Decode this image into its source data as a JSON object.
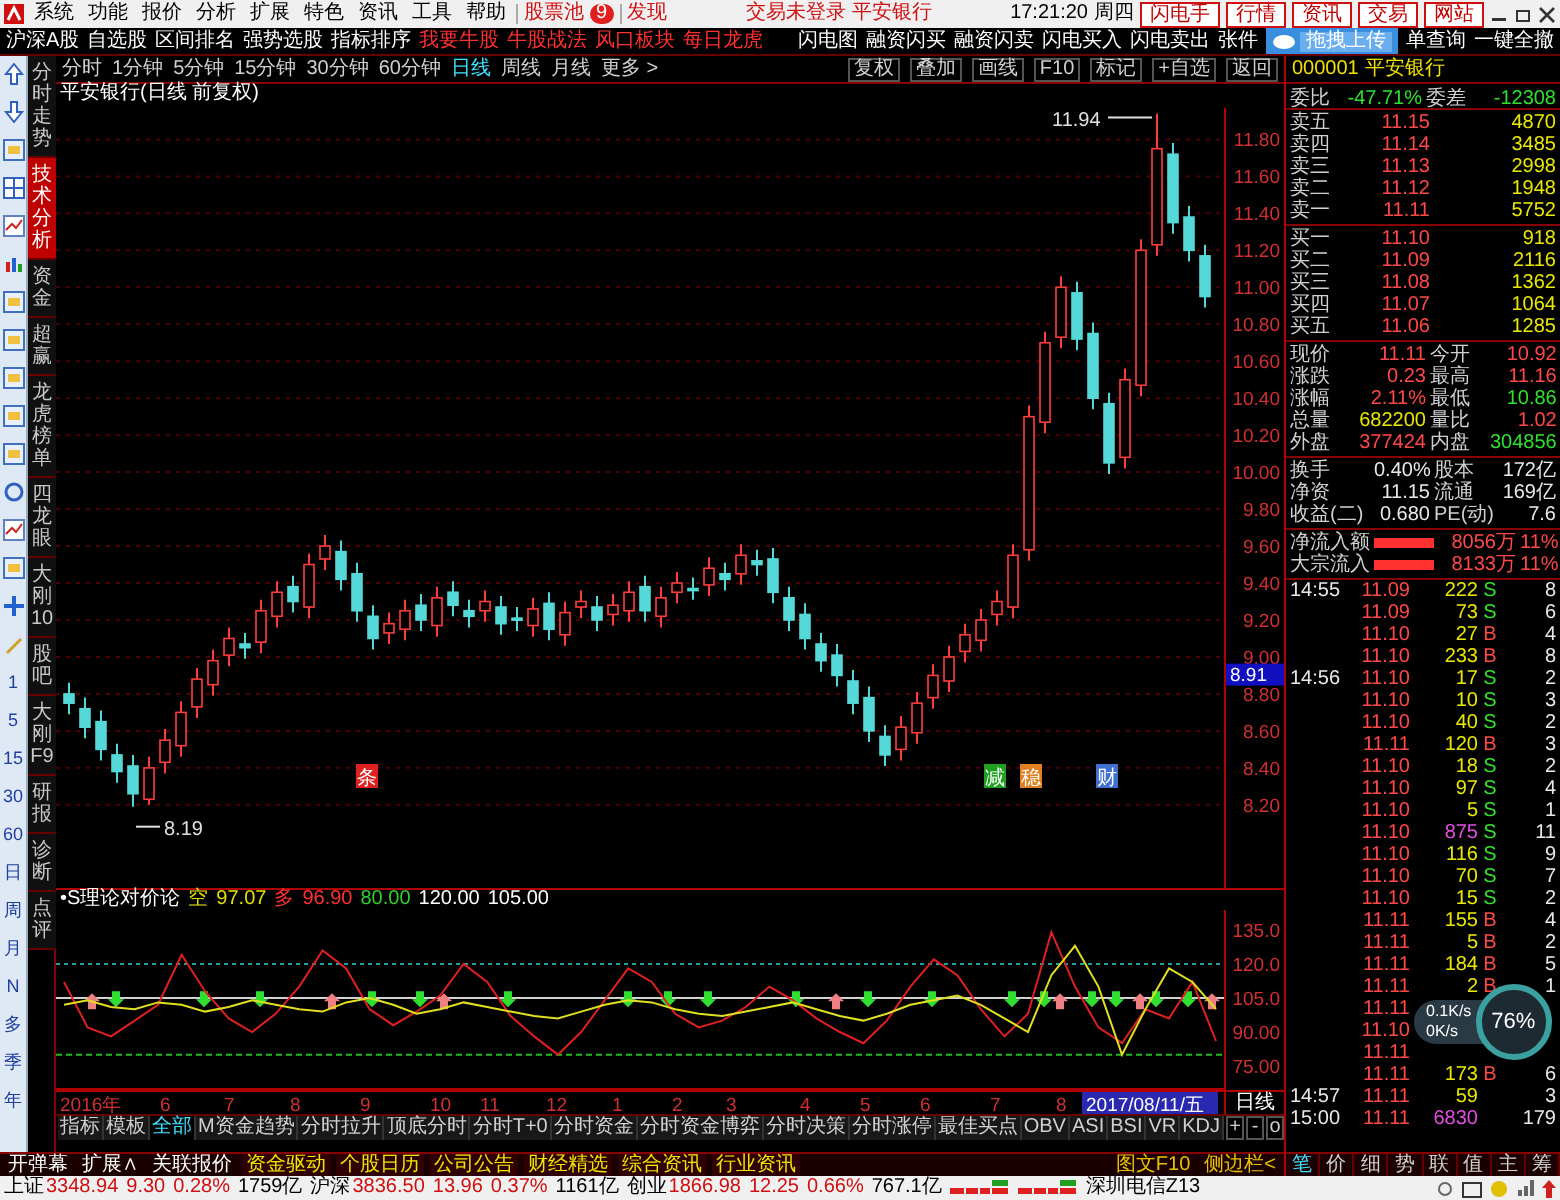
{
  "menu_bar": {
    "items": [
      "系统",
      "功能",
      "报价",
      "分析",
      "扩展",
      "特色",
      "资讯",
      "工具",
      "帮助"
    ],
    "stock_pool": "股票池",
    "stock_pool_count": "9",
    "discover": "发现",
    "login_status": "交易未登录",
    "stock_name": "平安银行",
    "time": "17:21:20",
    "weekday": "周四",
    "buttons": [
      "闪电手",
      "行情",
      "资讯",
      "交易",
      "网站"
    ]
  },
  "toolbar": {
    "left": [
      {
        "label": "沪深A股",
        "kind": "normal"
      },
      {
        "label": "自选股",
        "kind": "normal"
      },
      {
        "label": "区间排名",
        "kind": "normal"
      },
      {
        "label": "强势选股",
        "kind": "normal"
      },
      {
        "label": "指标排序",
        "kind": "normal"
      },
      {
        "label": "我要牛股",
        "kind": "promo"
      },
      {
        "label": "牛股战法",
        "kind": "promo"
      },
      {
        "label": "风口板块",
        "kind": "promo"
      },
      {
        "label": "每日龙虎",
        "kind": "promo"
      }
    ],
    "right": [
      "闪电图",
      "融资闪买",
      "融资闪卖",
      "闪电买入",
      "闪电卖出",
      "张件"
    ],
    "upload_popup": "拖拽上传",
    "right_after": [
      "单查询",
      "一键全撤"
    ]
  },
  "sidebar": {
    "period_keys": [
      "1",
      "5",
      "15",
      "30",
      "60",
      "日",
      "周",
      "月",
      "N",
      "多",
      "季",
      "年"
    ]
  },
  "vertical_tabs": [
    {
      "label": "分时走势",
      "selected": false
    },
    {
      "label": "技术分析",
      "selected": true
    },
    {
      "label": "资金",
      "selected": false
    },
    {
      "label": "超赢",
      "selected": false
    },
    {
      "label": "龙虎榜单",
      "selected": false
    },
    {
      "label": "四龙眼",
      "selected": false
    },
    {
      "label": "大刚10",
      "selected": false
    },
    {
      "label": "股吧",
      "selected": false
    },
    {
      "label": "大刚F9",
      "selected": false
    },
    {
      "label": "研报",
      "selected": false
    },
    {
      "label": "诊断",
      "selected": false
    },
    {
      "label": "点评",
      "selected": false
    }
  ],
  "period_bar": {
    "periods": [
      {
        "label": "分时",
        "selected": false
      },
      {
        "label": "1分钟",
        "selected": false
      },
      {
        "label": "5分钟",
        "selected": false
      },
      {
        "label": "15分钟",
        "selected": false
      },
      {
        "label": "30分钟",
        "selected": false
      },
      {
        "label": "60分钟",
        "selected": false
      },
      {
        "label": "日线",
        "selected": true
      },
      {
        "label": "周线",
        "selected": false
      },
      {
        "label": "月线",
        "selected": false
      },
      {
        "label": "更多 >",
        "selected": false
      }
    ],
    "actions": [
      "复权",
      "叠加",
      "画线",
      "F10",
      "标记",
      "+自选",
      "返回"
    ]
  },
  "price_chart": {
    "title": "平安银行(日线 前复权)",
    "chart_data": {
      "type": "candlestick",
      "grid": true,
      "ylim": [
        7.75,
        11.97
      ],
      "yticks": [
        {
          "value": 11.8,
          "label": "11.80"
        },
        {
          "value": 11.6,
          "label": "11.60"
        },
        {
          "value": 11.4,
          "label": "11.40"
        },
        {
          "value": 11.2,
          "label": "11.20"
        },
        {
          "value": 11.0,
          "label": "11.00"
        },
        {
          "value": 10.8,
          "label": "10.80"
        },
        {
          "value": 10.6,
          "label": "10.60"
        },
        {
          "value": 10.4,
          "label": "10.40"
        },
        {
          "value": 10.2,
          "label": "10.20"
        },
        {
          "value": 10.0,
          "label": "10.00"
        },
        {
          "value": 9.8,
          "label": "9.80"
        },
        {
          "value": 9.6,
          "label": "9.60"
        },
        {
          "value": 9.4,
          "label": "9.40"
        },
        {
          "value": 9.2,
          "label": "9.20"
        },
        {
          "value": 9.0,
          "label": "9.00"
        },
        {
          "value": 8.8,
          "label": "8.80"
        },
        {
          "value": 8.6,
          "label": "8.60"
        },
        {
          "value": 8.4,
          "label": "8.40"
        },
        {
          "value": 8.2,
          "label": "8.20"
        }
      ],
      "ohlc": [
        [
          8.8,
          8.86,
          8.69,
          8.75
        ],
        [
          8.72,
          8.78,
          8.56,
          8.62
        ],
        [
          8.65,
          8.71,
          8.44,
          8.5
        ],
        [
          8.47,
          8.53,
          8.32,
          8.38
        ],
        [
          8.41,
          8.47,
          8.19,
          8.26
        ],
        [
          8.23,
          8.46,
          8.2,
          8.4
        ],
        [
          8.43,
          8.61,
          8.37,
          8.55
        ],
        [
          8.52,
          8.76,
          8.46,
          8.7
        ],
        [
          8.73,
          8.94,
          8.67,
          8.88
        ],
        [
          8.85,
          9.04,
          8.79,
          8.98
        ],
        [
          9.01,
          9.16,
          8.95,
          9.1
        ],
        [
          9.07,
          9.13,
          8.99,
          9.05
        ],
        [
          9.08,
          9.31,
          9.02,
          9.25
        ],
        [
          9.22,
          9.41,
          9.16,
          9.35
        ],
        [
          9.38,
          9.44,
          9.24,
          9.3
        ],
        [
          9.27,
          9.56,
          9.21,
          9.5
        ],
        [
          9.53,
          9.66,
          9.47,
          9.6
        ],
        [
          9.57,
          9.63,
          9.36,
          9.42
        ],
        [
          9.45,
          9.51,
          9.19,
          9.25
        ],
        [
          9.22,
          9.28,
          9.04,
          9.1
        ],
        [
          9.13,
          9.24,
          9.07,
          9.18
        ],
        [
          9.15,
          9.31,
          9.09,
          9.25
        ],
        [
          9.28,
          9.34,
          9.14,
          9.2
        ],
        [
          9.17,
          9.38,
          9.11,
          9.32
        ],
        [
          9.35,
          9.41,
          9.22,
          9.28
        ],
        [
          9.25,
          9.31,
          9.16,
          9.22
        ],
        [
          9.25,
          9.36,
          9.19,
          9.3
        ],
        [
          9.27,
          9.33,
          9.12,
          9.18
        ],
        [
          9.21,
          9.27,
          9.14,
          9.2
        ],
        [
          9.17,
          9.32,
          9.11,
          9.26
        ],
        [
          9.29,
          9.35,
          9.09,
          9.15
        ],
        [
          9.12,
          9.3,
          9.06,
          9.24
        ],
        [
          9.27,
          9.36,
          9.21,
          9.3
        ],
        [
          9.27,
          9.33,
          9.14,
          9.2
        ],
        [
          9.23,
          9.34,
          9.17,
          9.28
        ],
        [
          9.25,
          9.41,
          9.19,
          9.35
        ],
        [
          9.38,
          9.44,
          9.19,
          9.25
        ],
        [
          9.22,
          9.38,
          9.16,
          9.32
        ],
        [
          9.35,
          9.46,
          9.29,
          9.4
        ],
        [
          9.37,
          9.43,
          9.31,
          9.36
        ],
        [
          9.39,
          9.54,
          9.33,
          9.48
        ],
        [
          9.45,
          9.51,
          9.36,
          9.42
        ],
        [
          9.45,
          9.61,
          9.39,
          9.55
        ],
        [
          9.52,
          9.58,
          9.44,
          9.5
        ],
        [
          9.53,
          9.59,
          9.29,
          9.35
        ],
        [
          9.32,
          9.38,
          9.14,
          9.2
        ],
        [
          9.23,
          9.29,
          9.04,
          9.1
        ],
        [
          9.07,
          9.13,
          8.92,
          8.98
        ],
        [
          9.01,
          9.07,
          8.84,
          8.9
        ],
        [
          8.87,
          8.93,
          8.69,
          8.75
        ],
        [
          8.78,
          8.84,
          8.54,
          8.6
        ],
        [
          8.57,
          8.63,
          8.41,
          8.47
        ],
        [
          8.5,
          8.68,
          8.44,
          8.62
        ],
        [
          8.59,
          8.81,
          8.53,
          8.75
        ],
        [
          8.78,
          8.96,
          8.72,
          8.9
        ],
        [
          8.87,
          9.06,
          8.81,
          9.0
        ],
        [
          9.03,
          9.18,
          8.97,
          9.12
        ],
        [
          9.09,
          9.26,
          9.03,
          9.2
        ],
        [
          9.23,
          9.36,
          9.17,
          9.3
        ],
        [
          9.27,
          9.61,
          9.21,
          9.55
        ],
        [
          9.58,
          10.36,
          9.52,
          10.3
        ],
        [
          10.27,
          10.76,
          10.21,
          10.7
        ],
        [
          10.73,
          11.06,
          10.67,
          11.0
        ],
        [
          10.97,
          11.03,
          10.66,
          10.72
        ],
        [
          10.75,
          10.81,
          10.34,
          10.4
        ],
        [
          10.37,
          10.43,
          9.99,
          10.05
        ],
        [
          10.08,
          10.56,
          10.02,
          10.5
        ],
        [
          10.47,
          11.26,
          10.41,
          11.2
        ],
        [
          11.23,
          11.94,
          11.17,
          11.75
        ],
        [
          11.72,
          11.78,
          11.29,
          11.35
        ],
        [
          11.38,
          11.44,
          11.14,
          11.2
        ],
        [
          11.17,
          11.23,
          10.89,
          10.95
        ]
      ]
    },
    "high_label": "11.94",
    "low_label": "8.19",
    "current_marker": "8.91",
    "event_markers": [
      {
        "label": "条",
        "color": "#e02020"
      },
      {
        "label": "减",
        "color": "#20a020"
      },
      {
        "label": "稳",
        "color": "#e08020"
      },
      {
        "label": "财",
        "color": "#4070d0"
      }
    ]
  },
  "indicator": {
    "header": [
      {
        "text": "•S理论对价论",
        "color": "#ffffff"
      },
      {
        "text": "空",
        "color": "#e0e000"
      },
      {
        "text": "97.07",
        "color": "#e0e000"
      },
      {
        "text": "多",
        "color": "#ff3030"
      },
      {
        "text": "96.90",
        "color": "#ff3030"
      },
      {
        "text": "80.00",
        "color": "#30d030"
      },
      {
        "text": "120.00",
        "color": "#ffffff"
      },
      {
        "text": "105.00",
        "color": "#ffffff"
      }
    ],
    "chart_data": {
      "type": "line",
      "ylim": [
        64.4,
        143.8
      ],
      "yticks": [
        {
          "value": 135,
          "label": "135.0"
        },
        {
          "value": 120,
          "label": "120.0"
        },
        {
          "value": 105,
          "label": "105.0"
        },
        {
          "value": 90,
          "label": "90.00"
        },
        {
          "value": 75,
          "label": "75.00"
        }
      ],
      "series": [
        {
          "color": "#e02020",
          "values": [
            112,
            92,
            88,
            95,
            102,
            124,
            108,
            96,
            90,
            98,
            110,
            126,
            118,
            100,
            93,
            99,
            106,
            120,
            112,
            97,
            88,
            80,
            90,
            104,
            118,
            112,
            98,
            92,
            95,
            101,
            110,
            104,
            96,
            90,
            85,
            95,
            110,
            122,
            115,
            100,
            88,
            98,
            134,
            110,
            92,
            85,
            100,
            96,
            112,
            86
          ]
        },
        {
          "color": "#e0e020",
          "values": [
            102,
            104,
            101,
            100,
            103,
            102,
            99,
            101,
            104,
            102,
            100,
            99,
            103,
            105,
            102,
            98,
            100,
            103,
            101,
            99,
            97,
            96,
            99,
            102,
            104,
            103,
            100,
            98,
            97,
            99,
            101,
            103,
            100,
            97,
            95,
            98,
            102,
            104,
            106,
            102,
            96,
            90,
            115,
            128,
            110,
            80,
            100,
            118,
            112,
            100
          ]
        }
      ]
    }
  },
  "date_axis": {
    "labels": [
      "2016年",
      "6",
      "7",
      "8",
      "9",
      "10",
      "11",
      "12",
      "1",
      "2",
      "3",
      "4",
      "5",
      "6",
      "7",
      "8"
    ],
    "cursor_date": "2017/08/11/五",
    "period": "日线"
  },
  "indicator_tabs": {
    "tabs": [
      {
        "label": "指标",
        "selected": false
      },
      {
        "label": "模板",
        "selected": false
      },
      {
        "label": "全部",
        "selected": true
      },
      {
        "label": "M资金趋势",
        "selected": false
      },
      {
        "label": "分时拉升",
        "selected": false
      },
      {
        "label": "顶底分时",
        "selected": false
      },
      {
        "label": "分时T+0",
        "selected": false
      },
      {
        "label": "分时资金",
        "selected": false
      },
      {
        "label": "分时资金博弈",
        "selected": false
      },
      {
        "label": "分时决策",
        "selected": false
      },
      {
        "label": "分时涨停",
        "selected": false
      },
      {
        "label": "最佳买点",
        "selected": false
      },
      {
        "label": "OBV",
        "selected": false
      },
      {
        "label": "ASI",
        "selected": false
      },
      {
        "label": "BSI",
        "selected": false
      },
      {
        "label": "VR",
        "selected": false
      },
      {
        "label": "KDJ",
        "selected": false
      }
    ],
    "zoom_buttons": [
      "+",
      "-",
      "o"
    ]
  },
  "bottom_bar": {
    "left": [
      {
        "label": "开弹幕",
        "kind": "plain"
      },
      {
        "label": "扩展∧",
        "kind": "plain"
      },
      {
        "label": "关联报价",
        "kind": "plain"
      },
      {
        "label": "资金驱动",
        "kind": "news"
      },
      {
        "label": "个股日历",
        "kind": "news"
      },
      {
        "label": "公司公告",
        "kind": "news"
      },
      {
        "label": "财经精选",
        "kind": "news"
      },
      {
        "label": "综合资讯",
        "kind": "news"
      },
      {
        "label": "行业资讯",
        "kind": "news"
      }
    ],
    "right": [
      "图文F10",
      "侧边栏<"
    ]
  },
  "quote_panel": {
    "code": "000001",
    "name": "平安银行",
    "ratio": {
      "label": "委比",
      "value": "-47.71%",
      "diff_label": "委差",
      "diff": "-12308"
    },
    "asks": [
      {
        "label": "卖五",
        "price": "11.15",
        "volume": "4870"
      },
      {
        "label": "卖四",
        "price": "11.14",
        "volume": "3485"
      },
      {
        "label": "卖三",
        "price": "11.13",
        "volume": "2998"
      },
      {
        "label": "卖二",
        "price": "11.12",
        "volume": "1948"
      },
      {
        "label": "卖一",
        "price": "11.11",
        "volume": "5752"
      }
    ],
    "bids": [
      {
        "label": "买一",
        "price": "11.10",
        "volume": "918"
      },
      {
        "label": "买二",
        "price": "11.09",
        "volume": "2116"
      },
      {
        "label": "买三",
        "price": "11.08",
        "volume": "1362"
      },
      {
        "label": "买四",
        "price": "11.07",
        "volume": "1064"
      },
      {
        "label": "买五",
        "price": "11.06",
        "volume": "1285"
      }
    ],
    "stats": [
      {
        "label": "现价",
        "value": "11.11",
        "kind": "up"
      },
      {
        "label": "今开",
        "value": "10.92",
        "kind": "up"
      },
      {
        "label": "涨跌",
        "value": "0.23",
        "kind": "up"
      },
      {
        "label": "最高",
        "value": "11.16",
        "kind": "up"
      },
      {
        "label": "涨幅",
        "value": "2.11%",
        "kind": "up"
      },
      {
        "label": "最低",
        "value": "10.86",
        "kind": "down"
      },
      {
        "label": "总量",
        "value": "682200",
        "kind": "volume"
      },
      {
        "label": "量比",
        "value": "1.02",
        "kind": "up"
      },
      {
        "label": "外盘",
        "value": "377424",
        "kind": "up"
      },
      {
        "label": "内盘",
        "value": "304856",
        "kind": "down"
      }
    ],
    "fundamentals": [
      {
        "label": "换手",
        "value": "0.40%",
        "label2": "股本",
        "value2": "172亿"
      },
      {
        "label": "净资",
        "value": "11.15",
        "label2": "流通",
        "value2": "169亿"
      },
      {
        "label": "收益(二)",
        "value": "0.680",
        "label2": "PE(动)",
        "value2": "7.6"
      }
    ],
    "flows": [
      {
        "label": "净流入额",
        "value": "8056万",
        "pct": "11%"
      },
      {
        "label": "大宗流入",
        "value": "8133万",
        "pct": "11%"
      }
    ],
    "ticks": [
      {
        "time": "14:55",
        "price": "11.09",
        "volume": "222",
        "side": "S",
        "kind": "sell",
        "count": "8",
        "large": false
      },
      {
        "price": "11.09",
        "volume": "73",
        "side": "S",
        "kind": "sell",
        "count": "6",
        "large": false
      },
      {
        "price": "11.10",
        "volume": "27",
        "side": "B",
        "kind": "buy",
        "count": "4",
        "large": false
      },
      {
        "price": "11.10",
        "volume": "233",
        "side": "B",
        "kind": "buy",
        "count": "8",
        "large": false
      },
      {
        "time": "14:56",
        "price": "11.10",
        "volume": "17",
        "side": "S",
        "kind": "sell",
        "count": "2",
        "large": false
      },
      {
        "price": "11.10",
        "volume": "10",
        "side": "S",
        "kind": "sell",
        "count": "3",
        "large": false
      },
      {
        "price": "11.10",
        "volume": "40",
        "side": "S",
        "kind": "sell",
        "count": "2",
        "large": false
      },
      {
        "price": "11.11",
        "volume": "120",
        "side": "B",
        "kind": "buy",
        "count": "3",
        "large": false
      },
      {
        "price": "11.10",
        "volume": "18",
        "side": "S",
        "kind": "sell",
        "count": "2",
        "large": false
      },
      {
        "price": "11.10",
        "volume": "97",
        "side": "S",
        "kind": "sell",
        "count": "4",
        "large": false
      },
      {
        "price": "11.10",
        "volume": "5",
        "side": "S",
        "kind": "sell",
        "count": "1",
        "large": false
      },
      {
        "price": "11.10",
        "volume": "875",
        "side": "S",
        "kind": "sell",
        "count": "11",
        "large": true
      },
      {
        "price": "11.10",
        "volume": "116",
        "side": "S",
        "kind": "sell",
        "count": "9",
        "large": false
      },
      {
        "price": "11.10",
        "volume": "70",
        "side": "S",
        "kind": "sell",
        "count": "7",
        "large": false
      },
      {
        "price": "11.10",
        "volume": "15",
        "side": "S",
        "kind": "sell",
        "count": "2",
        "large": false
      },
      {
        "price": "11.11",
        "volume": "155",
        "side": "B",
        "kind": "buy",
        "count": "4",
        "large": false
      },
      {
        "price": "11.11",
        "volume": "5",
        "side": "B",
        "kind": "buy",
        "count": "2",
        "large": false
      },
      {
        "price": "11.11",
        "volume": "184",
        "side": "B",
        "kind": "buy",
        "count": "5",
        "large": false
      },
      {
        "price": "11.11",
        "volume": "2",
        "side": "B",
        "kind": "buy",
        "count": "1",
        "large": false
      },
      {
        "price": "11.11"
      },
      {
        "price": "11.10"
      },
      {
        "price": "11.11"
      },
      {
        "price": "11.11",
        "volume": "173",
        "side": "B",
        "kind": "buy",
        "count": "6",
        "large": false
      },
      {
        "time": "14:57",
        "price": "11.11",
        "volume": "59",
        "count": "3",
        "large": false
      },
      {
        "time": "15:00",
        "price": "11.11",
        "volume": "6830",
        "count": "179",
        "large": true
      }
    ],
    "tabs": [
      {
        "label": "笔",
        "selected": true
      },
      {
        "label": "价",
        "selected": false
      },
      {
        "label": "细",
        "selected": false
      },
      {
        "label": "势",
        "selected": false
      },
      {
        "label": "联",
        "selected": false
      },
      {
        "label": "值",
        "selected": false
      },
      {
        "label": "主",
        "selected": false
      },
      {
        "label": "筹",
        "selected": false
      }
    ]
  },
  "speed_widget": {
    "upload": "0.1K/s",
    "download": "0K/s",
    "percent": "76%"
  },
  "status_bar": {
    "indices": [
      {
        "name": "上证",
        "value": "3348.94",
        "change": "9.30",
        "pct": "0.28%",
        "amount": "1759亿"
      },
      {
        "name": "沪深",
        "value": "3836.50",
        "change": "13.96",
        "pct": "0.37%",
        "amount": "1161亿"
      },
      {
        "name": "创业",
        "value": "1866.98",
        "change": "12.25",
        "pct": "0.66%",
        "amount": "767.1亿"
      }
    ],
    "server": "深圳电信Z13"
  }
}
